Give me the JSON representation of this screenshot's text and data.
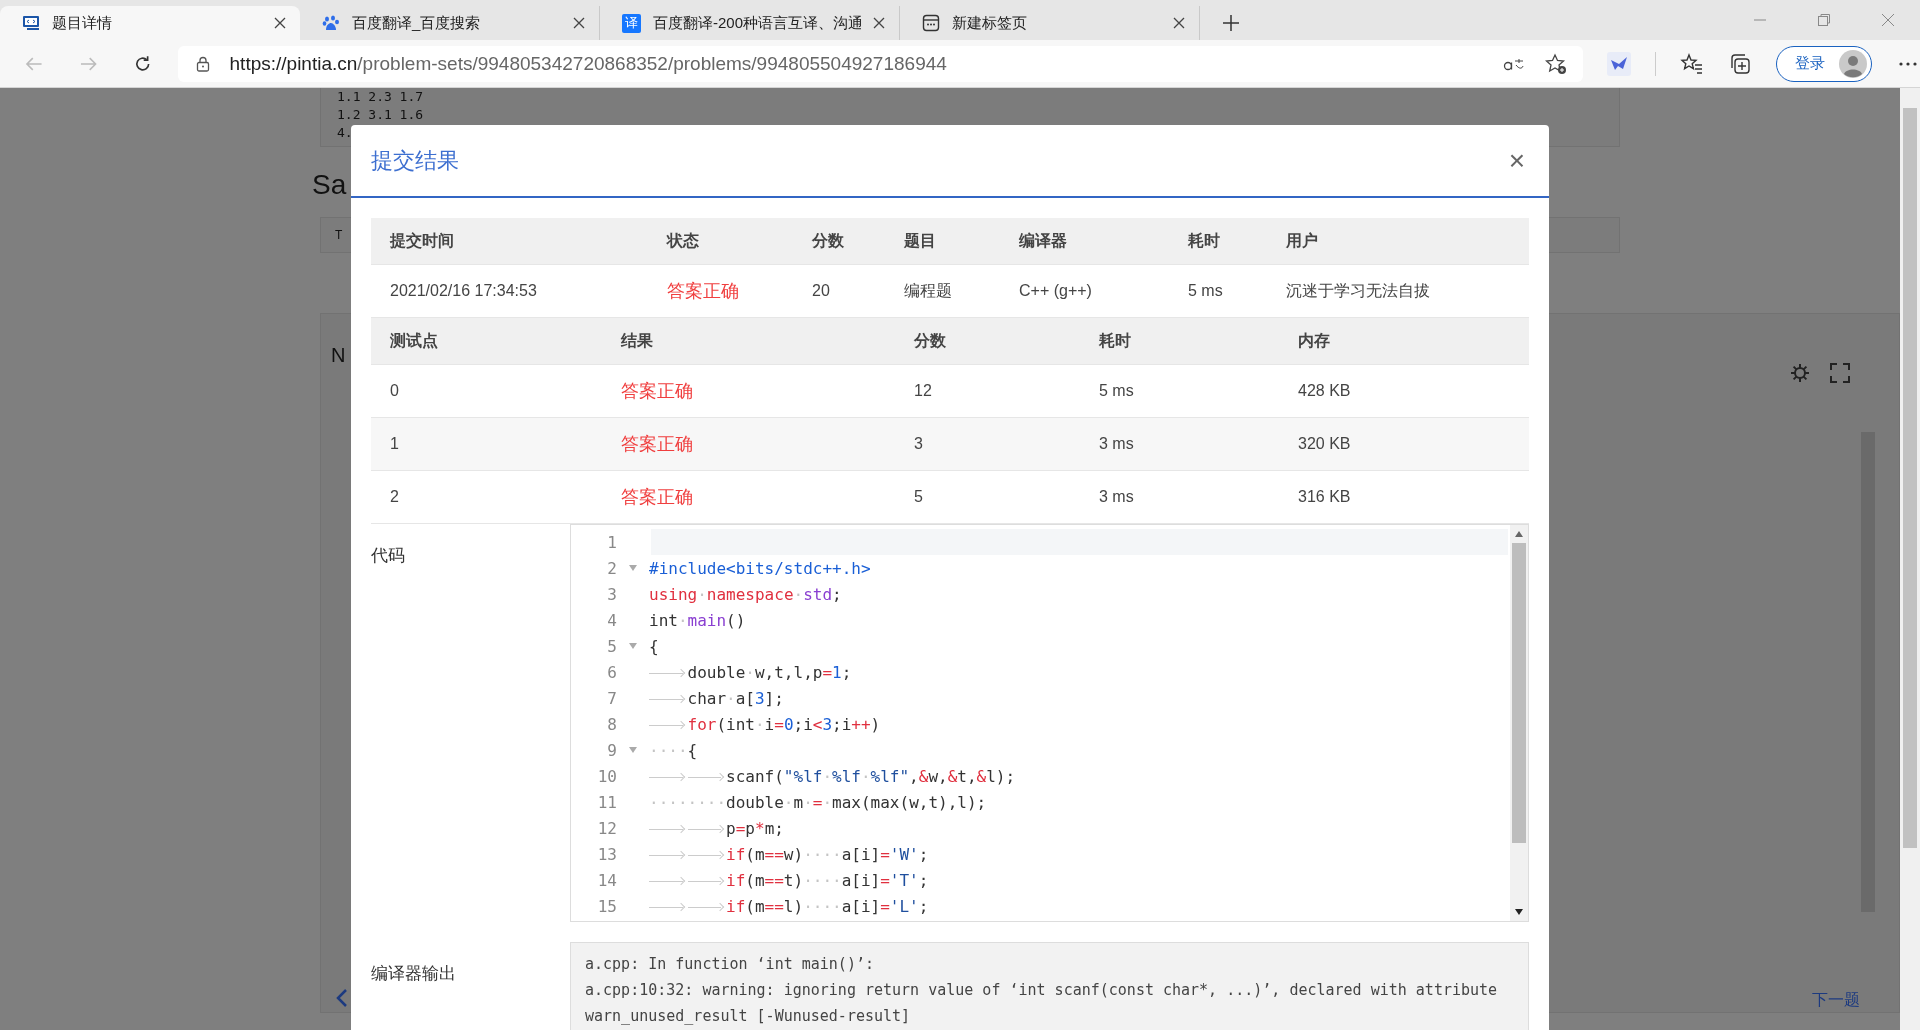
{
  "browser": {
    "tabs": [
      {
        "title": "题目详情",
        "selected": true,
        "kind": "code"
      },
      {
        "title": "百度翻译_百度搜索",
        "selected": false,
        "kind": "paw"
      },
      {
        "title": "百度翻译-200种语言互译、沟通",
        "selected": false,
        "kind": "translate",
        "icon_text": "译"
      },
      {
        "title": "新建标签页",
        "selected": false,
        "kind": "newtab"
      }
    ],
    "url_host": "https://pintia.cn",
    "url_path": "/problem-sets/994805342720868352/problems/994805504927186944",
    "login": "登录"
  },
  "background_page": {
    "sample_lines": [
      "1.1 2.3 1.7",
      "1.2 3.1 1.6",
      "4."
    ],
    "heading": "Sa",
    "tab_letter": "T",
    "panel_letter": "N",
    "next": "下一题"
  },
  "modal": {
    "title": "提交结果",
    "close": "×",
    "summary": {
      "columns": [
        "提交时间",
        "状态",
        "分数",
        "题目",
        "编译器",
        "耗时",
        "用户"
      ],
      "row": [
        "2021/02/16 17:34:53",
        "答案正确",
        "20",
        "编程题",
        "C++ (g++)",
        "5 ms",
        "沉迷于学习无法自拔"
      ]
    },
    "tests": {
      "columns": [
        "测试点",
        "结果",
        "分数",
        "耗时",
        "内存"
      ],
      "rows": [
        [
          "0",
          "答案正确",
          "12",
          "5 ms",
          "428 KB"
        ],
        [
          "1",
          "答案正确",
          "3",
          "3 ms",
          "320 KB"
        ],
        [
          "2",
          "答案正确",
          "5",
          "3 ms",
          "316 KB"
        ]
      ]
    },
    "code_label": "代码",
    "code_lines": [
      {
        "n": "1",
        "fold": false,
        "active": true
      },
      {
        "n": "2",
        "fold": true,
        "active": false,
        "tokens": [
          {
            "t": "#include<bits/stdc++.h>",
            "kind": "dir"
          }
        ]
      },
      {
        "n": "3",
        "fold": false,
        "active": false,
        "tokens": [
          {
            "t": "using",
            "kind": "kw"
          },
          {
            "t": "·",
            "kind": "ws"
          },
          {
            "t": "namespace",
            "kind": "kw"
          },
          {
            "t": "·",
            "kind": "ws"
          },
          {
            "t": "std",
            "kind": "fn"
          },
          {
            "t": ";",
            "kind": "p"
          }
        ]
      },
      {
        "n": "4",
        "fold": false,
        "active": false,
        "tokens": [
          {
            "t": "int",
            "kind": "p"
          },
          {
            "t": "·",
            "kind": "ws"
          },
          {
            "t": "main",
            "kind": "fn"
          },
          {
            "t": "()",
            "kind": "p"
          }
        ]
      },
      {
        "n": "5",
        "fold": true,
        "active": false,
        "tokens": [
          {
            "t": "{",
            "kind": "p"
          }
        ]
      },
      {
        "n": "6",
        "fold": false,
        "active": false,
        "tokens": [
          {
            "kind": "tab"
          },
          {
            "t": "double",
            "kind": "p"
          },
          {
            "t": "·",
            "kind": "ws"
          },
          {
            "t": "w,t,l,p",
            "kind": "p"
          },
          {
            "t": "=",
            "kind": "op"
          },
          {
            "t": "1",
            "kind": "num"
          },
          {
            "t": ";",
            "kind": "p"
          }
        ]
      },
      {
        "n": "7",
        "fold": false,
        "active": false,
        "tokens": [
          {
            "kind": "tab"
          },
          {
            "t": "char",
            "kind": "p"
          },
          {
            "t": "·",
            "kind": "ws"
          },
          {
            "t": "a[",
            "kind": "p"
          },
          {
            "t": "3",
            "kind": "num"
          },
          {
            "t": "];",
            "kind": "p"
          }
        ]
      },
      {
        "n": "8",
        "fold": false,
        "active": false,
        "tokens": [
          {
            "kind": "tab"
          },
          {
            "t": "for",
            "kind": "kw"
          },
          {
            "t": "(int",
            "kind": "p"
          },
          {
            "t": "·",
            "kind": "ws"
          },
          {
            "t": "i",
            "kind": "p"
          },
          {
            "t": "=",
            "kind": "op"
          },
          {
            "t": "0",
            "kind": "num"
          },
          {
            "t": ";i",
            "kind": "p"
          },
          {
            "t": "<",
            "kind": "op"
          },
          {
            "t": "3",
            "kind": "num"
          },
          {
            "t": ";i",
            "kind": "p"
          },
          {
            "t": "++",
            "kind": "op"
          },
          {
            "t": ")",
            "kind": "p"
          }
        ]
      },
      {
        "n": "9",
        "fold": true,
        "active": false,
        "tokens": [
          {
            "t": "····",
            "kind": "ws"
          },
          {
            "t": "{",
            "kind": "p"
          }
        ]
      },
      {
        "n": "10",
        "fold": false,
        "active": false,
        "tokens": [
          {
            "kind": "tab"
          },
          {
            "kind": "tab"
          },
          {
            "t": "scanf(",
            "kind": "p"
          },
          {
            "t": "\"%lf",
            "kind": "str"
          },
          {
            "t": "·",
            "kind": "ws"
          },
          {
            "t": "%lf",
            "kind": "str"
          },
          {
            "t": "·",
            "kind": "ws"
          },
          {
            "t": "%lf\"",
            "kind": "str"
          },
          {
            "t": ",",
            "kind": "p"
          },
          {
            "t": "&",
            "kind": "op"
          },
          {
            "t": "w,",
            "kind": "p"
          },
          {
            "t": "&",
            "kind": "op"
          },
          {
            "t": "t,",
            "kind": "p"
          },
          {
            "t": "&",
            "kind": "op"
          },
          {
            "t": "l);",
            "kind": "p"
          }
        ]
      },
      {
        "n": "11",
        "fold": false,
        "active": false,
        "tokens": [
          {
            "t": "········",
            "kind": "ws"
          },
          {
            "t": "double",
            "kind": "p"
          },
          {
            "t": "·",
            "kind": "ws"
          },
          {
            "t": "m",
            "kind": "p"
          },
          {
            "t": "·",
            "kind": "ws"
          },
          {
            "t": "=",
            "kind": "op"
          },
          {
            "t": "·",
            "kind": "ws"
          },
          {
            "t": "max(max(w,t),l);",
            "kind": "p"
          }
        ]
      },
      {
        "n": "12",
        "fold": false,
        "active": false,
        "tokens": [
          {
            "kind": "tab"
          },
          {
            "kind": "tab"
          },
          {
            "t": "p",
            "kind": "p"
          },
          {
            "t": "=",
            "kind": "op"
          },
          {
            "t": "p",
            "kind": "p"
          },
          {
            "t": "*",
            "kind": "op"
          },
          {
            "t": "m;",
            "kind": "p"
          }
        ]
      },
      {
        "n": "13",
        "fold": false,
        "active": false,
        "tokens": [
          {
            "kind": "tab"
          },
          {
            "kind": "tab"
          },
          {
            "t": "if",
            "kind": "kw"
          },
          {
            "t": "(m",
            "kind": "p"
          },
          {
            "t": "==",
            "kind": "op"
          },
          {
            "t": "w)",
            "kind": "p"
          },
          {
            "t": "····",
            "kind": "ws"
          },
          {
            "t": "a[i]",
            "kind": "p"
          },
          {
            "t": "=",
            "kind": "op"
          },
          {
            "t": "'W'",
            "kind": "str"
          },
          {
            "t": ";",
            "kind": "p"
          }
        ]
      },
      {
        "n": "14",
        "fold": false,
        "active": false,
        "tokens": [
          {
            "kind": "tab"
          },
          {
            "kind": "tab"
          },
          {
            "t": "if",
            "kind": "kw"
          },
          {
            "t": "(m",
            "kind": "p"
          },
          {
            "t": "==",
            "kind": "op"
          },
          {
            "t": "t)",
            "kind": "p"
          },
          {
            "t": "····",
            "kind": "ws"
          },
          {
            "t": "a[i]",
            "kind": "p"
          },
          {
            "t": "=",
            "kind": "op"
          },
          {
            "t": "'T'",
            "kind": "str"
          },
          {
            "t": ";",
            "kind": "p"
          }
        ]
      },
      {
        "n": "15",
        "fold": false,
        "active": false,
        "tokens": [
          {
            "kind": "tab"
          },
          {
            "kind": "tab"
          },
          {
            "t": "if",
            "kind": "kw"
          },
          {
            "t": "(m",
            "kind": "p"
          },
          {
            "t": "==",
            "kind": "op"
          },
          {
            "t": "l)",
            "kind": "p"
          },
          {
            "t": "····",
            "kind": "ws"
          },
          {
            "t": "a[i]",
            "kind": "p"
          },
          {
            "t": "=",
            "kind": "op"
          },
          {
            "t": "'L'",
            "kind": "str"
          },
          {
            "t": ";",
            "kind": "p"
          }
        ]
      }
    ],
    "compiler_label": "编译器输出",
    "compiler_output": [
      "a.cpp: In function ‘int main()’:",
      "a.cpp:10:32: warning: ignoring return value of ‘int scanf(const char*, ...)’, declared with attribute warn_unused_result [-Wunused-result]"
    ]
  }
}
